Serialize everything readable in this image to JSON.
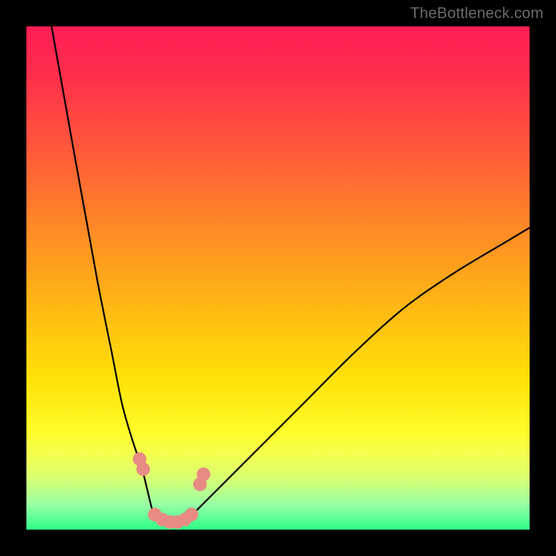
{
  "watermark": "TheBottleneck.com",
  "chart_data": {
    "type": "line",
    "title": "",
    "xlabel": "",
    "ylabel": "",
    "xlim": [
      0,
      100
    ],
    "ylim": [
      0,
      100
    ],
    "grid": false,
    "legend": false,
    "gradient_stops": [
      {
        "pct": 0,
        "color": "#ff1d55"
      },
      {
        "pct": 10,
        "color": "#ff2f4b"
      },
      {
        "pct": 25,
        "color": "#ff5a3a"
      },
      {
        "pct": 40,
        "color": "#ff8926"
      },
      {
        "pct": 55,
        "color": "#ffb614"
      },
      {
        "pct": 70,
        "color": "#ffe108"
      },
      {
        "pct": 80,
        "color": "#fffb26"
      },
      {
        "pct": 85,
        "color": "#f4ff4e"
      },
      {
        "pct": 90,
        "color": "#d7ff73"
      },
      {
        "pct": 95,
        "color": "#98ffa6"
      },
      {
        "pct": 100,
        "color": "#2dff87"
      }
    ],
    "series": [
      {
        "name": "curve",
        "x": [
          5,
          10,
          14,
          17,
          19,
          21,
          23,
          24,
          25,
          26,
          28,
          30,
          32,
          34,
          38,
          45,
          55,
          65,
          75,
          85,
          95,
          100
        ],
        "y": [
          100,
          72,
          50,
          35,
          25,
          18,
          12,
          8,
          4,
          2,
          1,
          1,
          2,
          4,
          8,
          15,
          25,
          35,
          44,
          51,
          57,
          60
        ]
      }
    ],
    "markers": [
      {
        "x": 22.5,
        "y": 14,
        "r": 1.4,
        "color": "#e78b84"
      },
      {
        "x": 23.2,
        "y": 12,
        "r": 1.4,
        "color": "#e78b84"
      },
      {
        "x": 25.5,
        "y": 3,
        "r": 1.4,
        "color": "#e78b84"
      },
      {
        "x": 27.0,
        "y": 2,
        "r": 1.4,
        "color": "#e78b84"
      },
      {
        "x": 28.5,
        "y": 1.5,
        "r": 1.4,
        "color": "#e78b84"
      },
      {
        "x": 30.0,
        "y": 1.5,
        "r": 1.4,
        "color": "#e78b84"
      },
      {
        "x": 31.5,
        "y": 2,
        "r": 1.4,
        "color": "#e78b84"
      },
      {
        "x": 32.8,
        "y": 3,
        "r": 1.4,
        "color": "#e78b84"
      },
      {
        "x": 34.5,
        "y": 9,
        "r": 1.4,
        "color": "#e78b84"
      },
      {
        "x": 35.2,
        "y": 11,
        "r": 1.4,
        "color": "#e78b84"
      }
    ]
  }
}
